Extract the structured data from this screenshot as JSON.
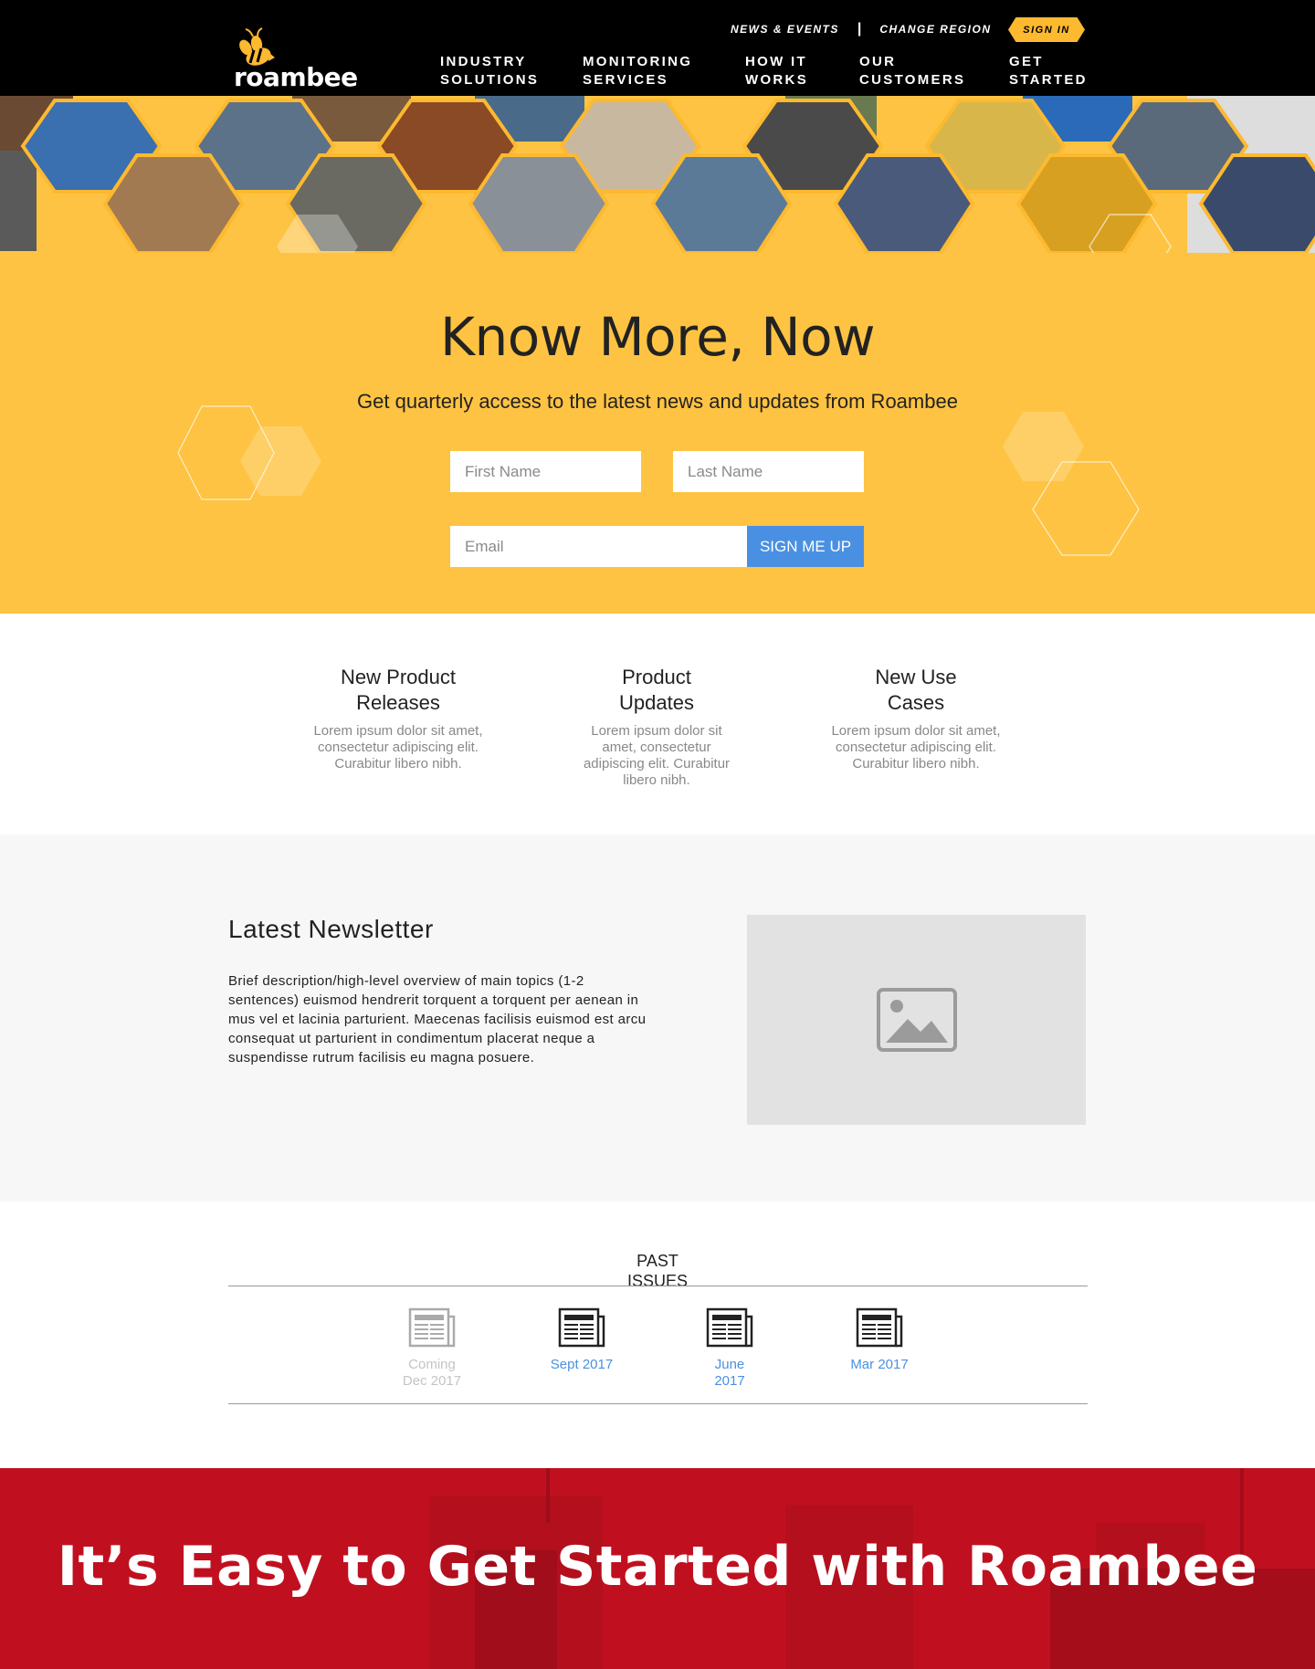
{
  "brand": {
    "name": "roambee"
  },
  "header": {
    "top_links": [
      "NEWS & EVENTS",
      "CHANGE REGION"
    ],
    "signin_label": "SIGN IN",
    "nav": [
      {
        "line1": "INDUSTRY",
        "line2": "SOLUTIONS"
      },
      {
        "line1": "MONITORING",
        "line2": "SERVICES"
      },
      {
        "line1": "HOW IT",
        "line2": "WORKS"
      },
      {
        "line1": "OUR",
        "line2": "CUSTOMERS"
      },
      {
        "line1": "GET",
        "line2": "STARTED"
      }
    ]
  },
  "hero": {
    "title": "Know More, Now",
    "subtitle": "Get quarterly access to the latest news and updates from Roambee",
    "first_name_placeholder": "First Name",
    "last_name_placeholder": "Last Name",
    "email_placeholder": "Email",
    "submit_label": "SIGN ME UP"
  },
  "features": [
    {
      "title": "New Product\nReleases",
      "desc": "Lorem ipsum dolor sit amet, consectetur adipiscing elit. Curabitur libero nibh."
    },
    {
      "title": "Product\nUpdates",
      "desc": "Lorem ipsum dolor sit amet, consectetur adipiscing elit. Curabitur libero nibh."
    },
    {
      "title": "New Use\nCases",
      "desc": "Lorem ipsum dolor sit amet, consectetur adipiscing elit. Curabitur libero nibh."
    }
  ],
  "newsletter": {
    "title": "Latest Newsletter",
    "description": "Brief description/high-level overview of main topics (1-2 sentences) euismod hendrerit torquent a torquent per aenean in mus vel et lacinia parturient. Maecenas facilisis euismod est arcu consequat ut parturient in condimentum placerat neque a suspendisse rutrum facilisis eu magna posuere."
  },
  "past_issues": {
    "title": "PAST\nISSUES",
    "items": [
      {
        "label": "Coming Dec 2017",
        "available": false
      },
      {
        "label": "Sept 2017",
        "available": true
      },
      {
        "label": "June 2017",
        "available": true
      },
      {
        "label": "Mar 2017",
        "available": true
      }
    ]
  },
  "cta": {
    "title": "It’s Easy to Get Started with Roambee"
  },
  "colors": {
    "header_bg": "#000000",
    "accent_yellow": "#fec342",
    "button_blue": "#4a90e2",
    "cta_red": "#c0101f"
  },
  "icons": [
    "bee-logo-icon",
    "image-placeholder-icon",
    "newspaper-icon"
  ]
}
